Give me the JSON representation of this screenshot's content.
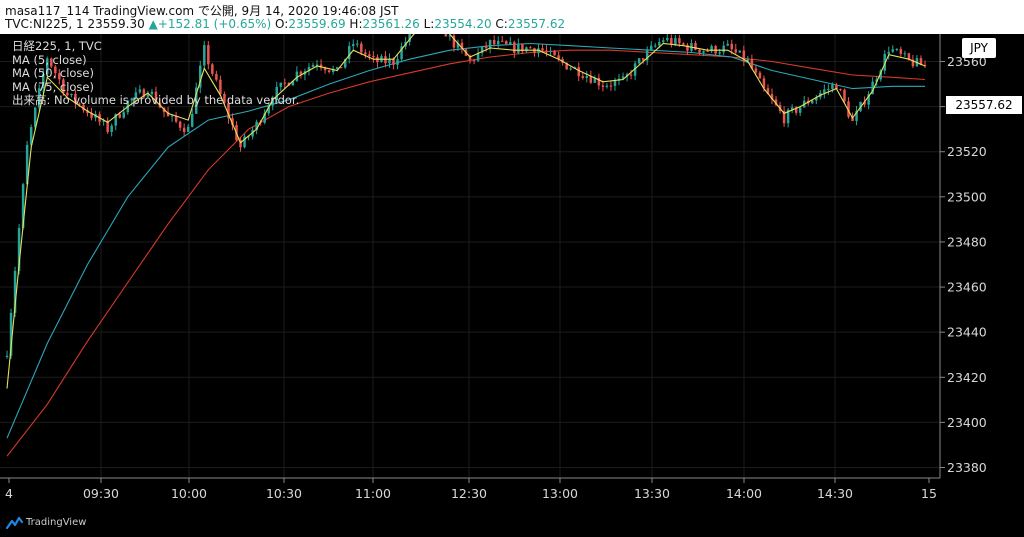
{
  "header": {
    "line1": "masa117_114 TradingView.com で公開, 9月 14, 2020 19:46:08 JST",
    "symbol": "TVC:NI225, 1",
    "last": "23559.30",
    "arrow": "▲",
    "change": "+152.81 (+0.65%)",
    "o_label": "O:",
    "o": "23559.69",
    "h_label": "H:",
    "h": "23561.26",
    "l_label": "L:",
    "l": "23554.20",
    "c_label": "C:",
    "c": "23557.62"
  },
  "legend": {
    "title": "日経225, 1, TVC",
    "ma5": "MA (5, close)",
    "ma50": "MA (50, close)",
    "ma75": "MA (75, close)",
    "volume": "出来高: No volume is provided by the data vendor."
  },
  "currency": "JPY",
  "last_price_tag": "23557.62",
  "branding": "TradingView",
  "colors": {
    "up": "#26a69a",
    "down": "#ef5350",
    "ma5": "#e6e25a",
    "ma50": "#2aa8b8",
    "ma75": "#d63a2a",
    "grid": "#1c1c1c",
    "axis_text": "#d8d8d8"
  },
  "chart_data": {
    "type": "candlestick",
    "title": "日経225, 1, TVC",
    "xlabel": "",
    "ylabel": "",
    "x_ticks": [
      "4",
      "09:30",
      "10:00",
      "10:30",
      "11:00",
      "12:30",
      "13:00",
      "13:30",
      "14:00",
      "14:30",
      "15"
    ],
    "y_ticks": [
      23380,
      23400,
      23420,
      23440,
      23460,
      23480,
      23500,
      23520,
      23540,
      23560
    ],
    "ylim": [
      23370,
      23572
    ],
    "grid": true,
    "key_points": [
      {
        "t": 0,
        "price": 23432
      },
      {
        "t": 5,
        "price": 23522
      },
      {
        "t": 10,
        "price": 23562
      },
      {
        "t": 15,
        "price": 23545
      },
      {
        "t": 20,
        "price": 23538
      },
      {
        "t": 25,
        "price": 23530
      },
      {
        "t": 30,
        "price": 23542
      },
      {
        "t": 35,
        "price": 23548
      },
      {
        "t": 40,
        "price": 23535
      },
      {
        "t": 45,
        "price": 23530
      },
      {
        "t": 49,
        "price": 23565
      },
      {
        "t": 53,
        "price": 23545
      },
      {
        "t": 58,
        "price": 23522
      },
      {
        "t": 62,
        "price": 23532
      },
      {
        "t": 66,
        "price": 23545
      },
      {
        "t": 72,
        "price": 23555
      },
      {
        "t": 77,
        "price": 23560
      },
      {
        "t": 82,
        "price": 23555
      },
      {
        "t": 86,
        "price": 23568
      },
      {
        "t": 91,
        "price": 23560
      },
      {
        "t": 96,
        "price": 23560
      },
      {
        "t": 101,
        "price": 23575
      },
      {
        "t": 106,
        "price": 23582
      },
      {
        "t": 110,
        "price": 23570
      },
      {
        "t": 115,
        "price": 23560
      },
      {
        "t": 120,
        "price": 23568
      },
      {
        "t": 126,
        "price": 23566
      },
      {
        "t": 132,
        "price": 23566
      },
      {
        "t": 137,
        "price": 23560
      },
      {
        "t": 142,
        "price": 23556
      },
      {
        "t": 148,
        "price": 23550
      },
      {
        "t": 153,
        "price": 23551
      },
      {
        "t": 158,
        "price": 23562
      },
      {
        "t": 163,
        "price": 23570
      },
      {
        "t": 168,
        "price": 23567
      },
      {
        "t": 174,
        "price": 23565
      },
      {
        "t": 179,
        "price": 23566
      },
      {
        "t": 184,
        "price": 23560
      },
      {
        "t": 188,
        "price": 23547
      },
      {
        "t": 193,
        "price": 23535
      },
      {
        "t": 197,
        "price": 23540
      },
      {
        "t": 202,
        "price": 23546
      },
      {
        "t": 206,
        "price": 23550
      },
      {
        "t": 210,
        "price": 23533
      },
      {
        "t": 215,
        "price": 23550
      },
      {
        "t": 219,
        "price": 23566
      },
      {
        "t": 224,
        "price": 23560
      },
      {
        "t": 228,
        "price": 23558
      }
    ],
    "series": [
      {
        "name": "MA (5, close)",
        "points": [
          [
            0,
            23415
          ],
          [
            3,
            23470
          ],
          [
            6,
            23522
          ],
          [
            10,
            23553
          ],
          [
            15,
            23544
          ],
          [
            20,
            23538
          ],
          [
            25,
            23533
          ],
          [
            30,
            23540
          ],
          [
            35,
            23546
          ],
          [
            40,
            23537
          ],
          [
            45,
            23534
          ],
          [
            49,
            23557
          ],
          [
            53,
            23545
          ],
          [
            58,
            23524
          ],
          [
            62,
            23530
          ],
          [
            66,
            23543
          ],
          [
            72,
            23553
          ],
          [
            77,
            23558
          ],
          [
            82,
            23556
          ],
          [
            86,
            23565
          ],
          [
            91,
            23561
          ],
          [
            96,
            23561
          ],
          [
            101,
            23572
          ],
          [
            106,
            23580
          ],
          [
            110,
            23572
          ],
          [
            115,
            23562
          ],
          [
            120,
            23566
          ],
          [
            126,
            23565
          ],
          [
            132,
            23565
          ],
          [
            137,
            23561
          ],
          [
            142,
            23556
          ],
          [
            148,
            23551
          ],
          [
            153,
            23552
          ],
          [
            158,
            23560
          ],
          [
            163,
            23568
          ],
          [
            168,
            23567
          ],
          [
            174,
            23565
          ],
          [
            179,
            23565
          ],
          [
            184,
            23560
          ],
          [
            188,
            23548
          ],
          [
            193,
            23537
          ],
          [
            197,
            23540
          ],
          [
            202,
            23545
          ],
          [
            206,
            23548
          ],
          [
            210,
            23535
          ],
          [
            215,
            23547
          ],
          [
            219,
            23563
          ],
          [
            224,
            23561
          ],
          [
            228,
            23558
          ]
        ]
      },
      {
        "name": "MA (50, close)",
        "points": [
          [
            0,
            23393
          ],
          [
            10,
            23435
          ],
          [
            20,
            23470
          ],
          [
            30,
            23500
          ],
          [
            40,
            23522
          ],
          [
            50,
            23534
          ],
          [
            60,
            23538
          ],
          [
            70,
            23543
          ],
          [
            80,
            23550
          ],
          [
            90,
            23556
          ],
          [
            100,
            23561
          ],
          [
            110,
            23565
          ],
          [
            120,
            23567
          ],
          [
            130,
            23568
          ],
          [
            140,
            23567
          ],
          [
            150,
            23566
          ],
          [
            160,
            23565
          ],
          [
            170,
            23564
          ],
          [
            180,
            23562
          ],
          [
            190,
            23556
          ],
          [
            200,
            23552
          ],
          [
            210,
            23548
          ],
          [
            220,
            23549
          ],
          [
            228,
            23549
          ]
        ]
      },
      {
        "name": "MA (75, close)",
        "points": [
          [
            0,
            23385
          ],
          [
            10,
            23408
          ],
          [
            20,
            23436
          ],
          [
            30,
            23462
          ],
          [
            40,
            23488
          ],
          [
            50,
            23512
          ],
          [
            60,
            23530
          ],
          [
            70,
            23540
          ],
          [
            80,
            23546
          ],
          [
            90,
            23551
          ],
          [
            100,
            23555
          ],
          [
            110,
            23559
          ],
          [
            120,
            23562
          ],
          [
            130,
            23564
          ],
          [
            140,
            23565
          ],
          [
            150,
            23565
          ],
          [
            160,
            23564
          ],
          [
            170,
            23563
          ],
          [
            180,
            23562
          ],
          [
            190,
            23560
          ],
          [
            200,
            23557
          ],
          [
            210,
            23554
          ],
          [
            220,
            23553
          ],
          [
            228,
            23552
          ]
        ]
      }
    ]
  }
}
